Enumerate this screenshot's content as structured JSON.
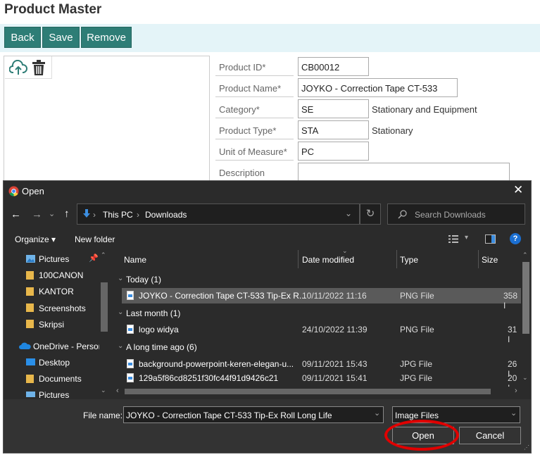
{
  "page": {
    "title": "Product Master"
  },
  "toolbar": {
    "back": "Back",
    "save": "Save",
    "remove": "Remove"
  },
  "form": {
    "product_id": {
      "label": "Product ID*",
      "value": "CB00012"
    },
    "product_name": {
      "label": "Product Name*",
      "value": "JOYKO - Correction Tape CT-533"
    },
    "category": {
      "label": "Category*",
      "value": "SE",
      "desc": "Stationary and Equipment"
    },
    "product_type": {
      "label": "Product Type*",
      "value": "STA",
      "desc": "Stationary"
    },
    "uom": {
      "label": "Unit of Measure*",
      "value": "PC"
    },
    "description": {
      "label": "Description",
      "value": ""
    }
  },
  "dialog": {
    "title": "Open",
    "breadcrumb": [
      "This PC",
      "Downloads"
    ],
    "search_placeholder": "Search Downloads",
    "organize": "Organize ▾",
    "new_folder": "New folder",
    "sidebar": [
      "Pictures",
      "100CANON",
      "KANTOR",
      "Screenshots",
      "Skripsi",
      "OneDrive - Person",
      "Desktop",
      "Documents",
      "Pictures"
    ],
    "columns": {
      "name": "Name",
      "date": "Date modified",
      "type": "Type",
      "size": "Size"
    },
    "groups": [
      {
        "label": "Today (1)",
        "files": [
          {
            "name": "JOYKO - Correction Tape CT-533 Tip-Ex R...",
            "date": "10/11/2022 11:16",
            "type": "PNG File",
            "size": "358 I"
          }
        ]
      },
      {
        "label": "Last month (1)",
        "files": [
          {
            "name": "logo widya",
            "date": "24/10/2022 11:39",
            "type": "PNG File",
            "size": "31 I"
          }
        ]
      },
      {
        "label": "A long time ago (6)",
        "files": [
          {
            "name": "background-powerpoint-keren-elegan-u...",
            "date": "09/11/2021 15:43",
            "type": "JPG File",
            "size": "26 I"
          },
          {
            "name": "129a5f86cd8251f30fc44f91d9426c21",
            "date": "09/11/2021 15:41",
            "type": "JPG File",
            "size": "20 I"
          }
        ]
      }
    ],
    "filename_label": "File name:",
    "filename_value": "JOYKO - Correction Tape CT-533 Tip-Ex Roll Long Life",
    "filter_value": "Image Files",
    "open": "Open",
    "cancel": "Cancel"
  },
  "colors": {
    "primary": "#2e7d76",
    "highlight": "#e00000"
  }
}
